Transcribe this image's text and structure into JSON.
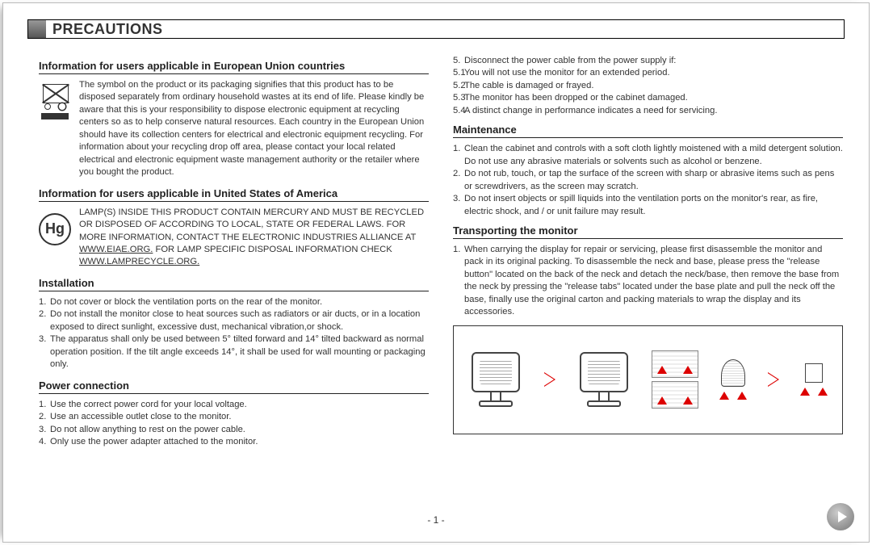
{
  "header": {
    "title": "PRECAUTIONS"
  },
  "page_number": "- 1 -",
  "left": {
    "sec1": {
      "title": "Information for users applicable in European Union countries",
      "body": "The symbol on the product or its packaging signifies that this product has to be disposed separately from ordinary household wastes at its end of life. Please kindly be aware that this is your responsibility to dispose electronic equipment at recycling centers so as to help conserve natural resources. Each country in the European Union should have its collection centers for electrical and electronic equipment recycling. For information about your recycling drop off area, please contact your local related electrical and electronic equipment waste management authority or the retailer where you bought the product."
    },
    "sec2": {
      "title": "Information for users applicable in United States of America",
      "hg_label": "Hg",
      "body_a": "LAMP(S) INSIDE THIS PRODUCT CONTAIN MERCURY AND MUST BE RECYCLED OR DISPOSED OF ACCORDING TO LOCAL, STATE OR FEDERAL LAWS. FOR MORE INFORMATION, CONTACT THE ELECTRONIC INDUSTRIES ALLIANCE AT ",
      "link1": "WWW.EIAE.ORG.",
      "body_b": " FOR LAMP SPECIFIC DISPOSAL INFORMATION CHECK ",
      "link2": "WWW.LAMPRECYCLE.ORG."
    },
    "sec3": {
      "title": "Installation",
      "items": [
        "Do not cover or block the ventilation ports on the rear of the monitor.",
        "Do not install the monitor close to heat sources such as radiators or air ducts, or in a location exposed to direct sunlight, excessive dust, mechanical vibration,or shock.",
        "The apparatus shall only be used between 5° tilted forward and 14° tilted backward as normal operation position. If the tilt angle exceeds 14°, it shall be used for wall mounting or packaging only."
      ]
    },
    "sec4": {
      "title": "Power connection",
      "items": [
        "Use the correct power cord for your local voltage.",
        "Use an accessible outlet close to the monitor.",
        "Do not allow anything to rest on the power cable.",
        "Only use the power adapter attached to the monitor."
      ]
    }
  },
  "right": {
    "sec5_items": {
      "lead": "Disconnect the power cable from the power supply if:",
      "subs": [
        "You will not use the monitor for an extended period.",
        "The cable is damaged or frayed.",
        "The monitor has been dropped or the cabinet damaged.",
        "A distinct change in performance indicates a need for servicing."
      ]
    },
    "sec6": {
      "title": "Maintenance",
      "items": [
        "Clean the cabinet and controls with a soft cloth lightly moistened with a mild detergent solution. Do not use any abrasive materials or solvents such as alcohol or benzene.",
        "Do not rub, touch, or tap the surface of the screen with sharp or abrasive items such as pens or screwdrivers, as the screen may scratch.",
        "Do not insert objects or spill liquids into the ventilation ports on the monitor's rear, as fire, electric shock, and / or unit failure may result."
      ]
    },
    "sec7": {
      "title": "Transporting the monitor",
      "items": [
        "When carrying the display for repair or servicing, please first disassemble the monitor and pack in its original packing. To disassemble the neck and base, please press the \"release button\" located on the back of the neck and detach the neck/base, then remove the base from the neck by pressing the \"release tabs\" located under the base plate and pull the neck off the base, finally use the original carton and packing materials to wrap the display and its accessories."
      ]
    }
  }
}
